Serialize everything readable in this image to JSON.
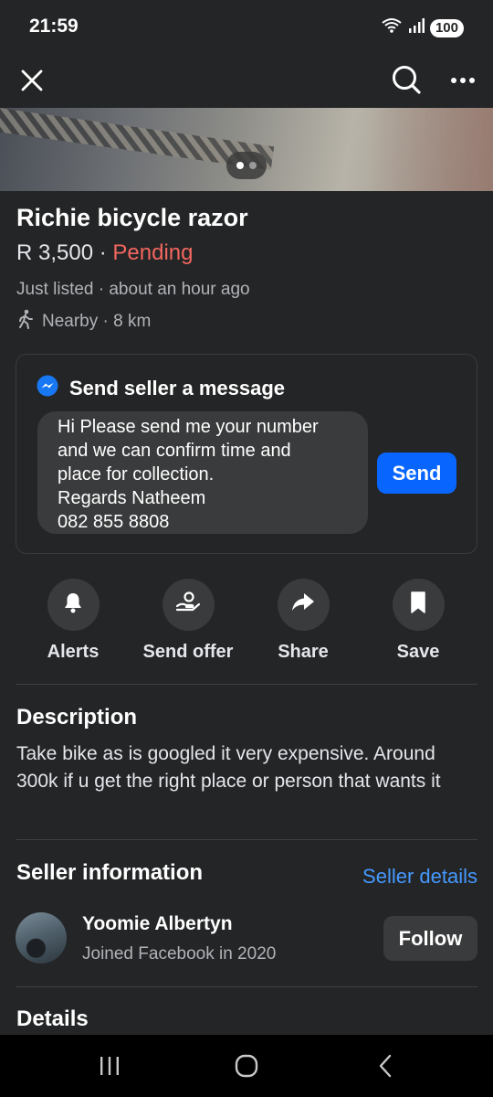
{
  "status_bar": {
    "time": "21:59",
    "battery": "100",
    "icons": [
      "wifi-icon",
      "signal-icon",
      "battery-icon"
    ]
  },
  "top_bar": {
    "icons": [
      "close-icon",
      "search-icon",
      "more-icon"
    ]
  },
  "photo": {
    "page_count": 2,
    "active_index": 0
  },
  "listing": {
    "title": "Richie bicycle razor",
    "price": "R 3,500",
    "separator": " · ",
    "status": "Pending",
    "listed": "Just listed · about an hour ago",
    "nearby": "Nearby · 8 km"
  },
  "message": {
    "header": "Send seller a message",
    "text": "Hi Please send me your number\nand we can confirm time and\nplace for collection.\nRegards Natheem\n082 855 8808",
    "send_label": "Send"
  },
  "actions": [
    {
      "label": "Alerts",
      "icon": "bell-icon"
    },
    {
      "label": "Send offer",
      "icon": "offer-icon"
    },
    {
      "label": "Share",
      "icon": "share-icon"
    },
    {
      "label": "Save",
      "icon": "bookmark-icon"
    }
  ],
  "description": {
    "title": "Description",
    "text": "Take bike as is googled it very expensive. Around 300k if u get the right place or person that wants it"
  },
  "seller": {
    "section_title": "Seller information",
    "details_link": "Seller details",
    "name": "Yoomie Albertyn",
    "joined": "Joined Facebook in 2020",
    "follow_label": "Follow"
  },
  "details": {
    "title": "Details"
  },
  "nav": {
    "icons": [
      "recents-icon",
      "home-icon",
      "back-icon"
    ]
  },
  "colors": {
    "background": "#242526",
    "accent": "#0866ff",
    "link": "#4599ff",
    "pending": "#f2675f"
  }
}
